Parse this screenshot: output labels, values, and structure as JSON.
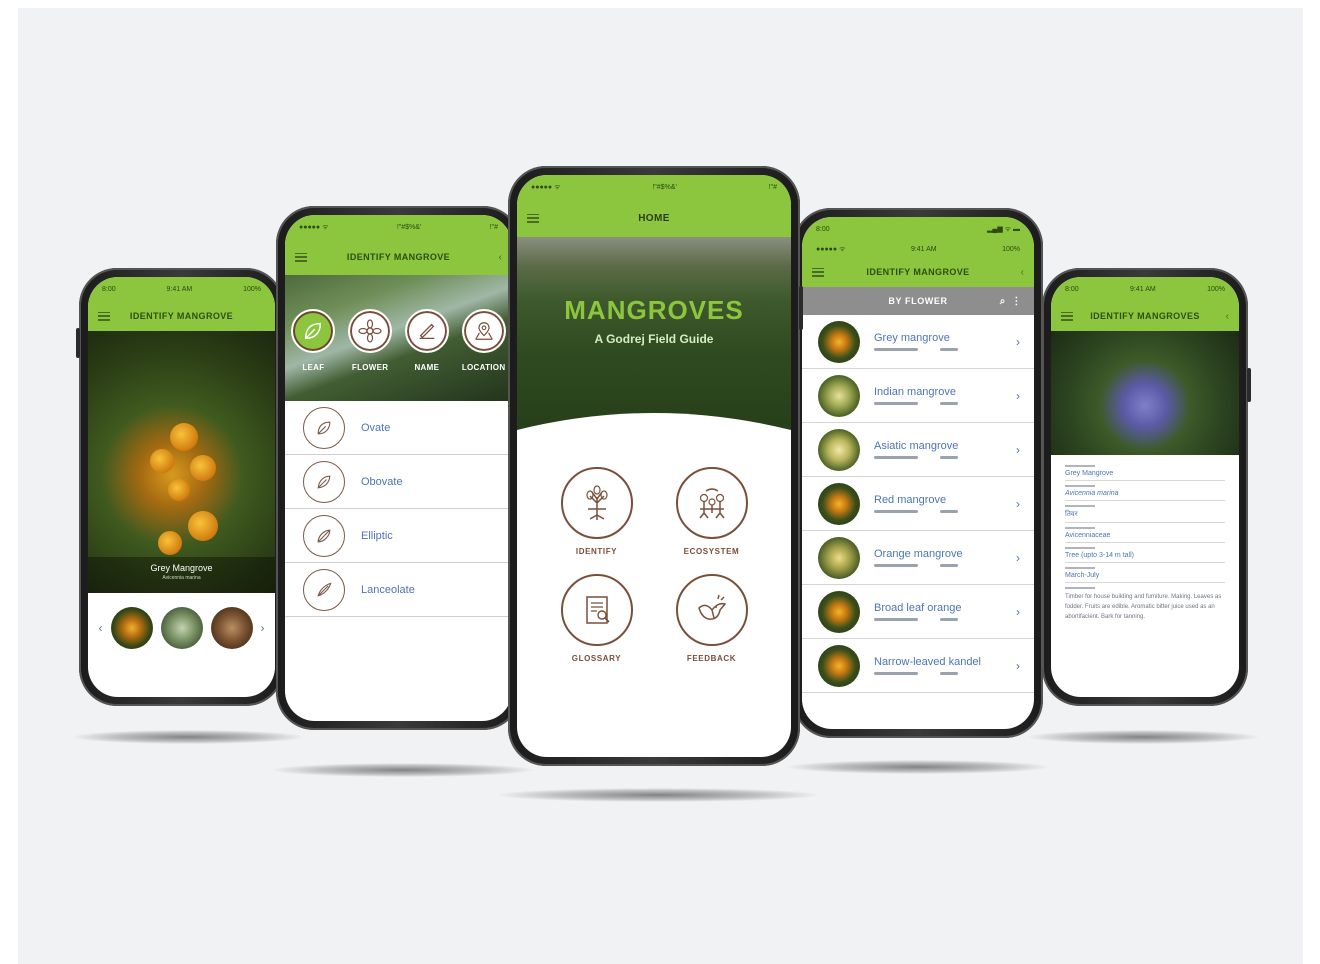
{
  "colors": {
    "app_green": "#8cc63f",
    "brown": "#7a4f3a",
    "link_blue": "#4d74b8",
    "background": "#f1f2f4"
  },
  "phone1": {
    "status": {
      "time": "9:41 AM",
      "left": "8:00",
      "battery": "100%"
    },
    "title": "IDENTIFY MANGROVE",
    "caption_name": "Grey Mangrove",
    "caption_sub": "Avicennia marina",
    "nav_prev": "‹",
    "nav_next": "›"
  },
  "phone2": {
    "status": {
      "carrier": "●●●●● ᯤ",
      "time": "!\"#$%&'",
      "right": "!\"#"
    },
    "title": "IDENTIFY MANGROVE",
    "categories": [
      {
        "label": "LEAF",
        "icon": "leaf-icon"
      },
      {
        "label": "FLOWER",
        "icon": "flower-icon"
      },
      {
        "label": "NAME",
        "icon": "pen-icon"
      },
      {
        "label": "LOCATION",
        "icon": "map-icon"
      }
    ],
    "leaf_shapes": [
      "Ovate",
      "Obovate",
      "Elliptic",
      "Lanceolate"
    ]
  },
  "phone3": {
    "status": {
      "carrier": "●●●●● ᯤ",
      "time": "!\"#$%&'",
      "right": "!\"#"
    },
    "title": "HOME",
    "hero_title": "MANGROVES",
    "hero_subtitle": "A Godrej Field Guide",
    "menu": [
      {
        "label": "IDENTIFY",
        "icon": "tree-roots-icon"
      },
      {
        "label": "ECOSYSTEM",
        "icon": "ecosystem-icon"
      },
      {
        "label": "GLOSSARY",
        "icon": "book-search-icon"
      },
      {
        "label": "FEEDBACK",
        "icon": "bird-icon"
      }
    ]
  },
  "phone4": {
    "status": {
      "left": "8:00",
      "time": "9:41 AM",
      "battery": "100%"
    },
    "title": "IDENTIFY MANGROVE",
    "filter": "BY FLOWER",
    "list": [
      "Grey mangrove",
      "Indian mangrove",
      "Asiatic mangrove",
      "Red mangrove",
      "Orange mangrove",
      "Broad leaf orange",
      "Narrow-leaved kandel"
    ]
  },
  "phone5": {
    "status": {
      "left": "8:00",
      "time": "9:41 AM",
      "battery": "100%"
    },
    "title": "IDENTIFY MANGROVES",
    "details": [
      "Grey Mangrove",
      "Avicennia marina",
      "तिवर",
      "Avicenniaceae",
      "Tree (upto 3-14 m tall)",
      "March-July"
    ],
    "uses": "Timber for house building and furniture. Making. Leaves as fodder. Fruits are edible. Aromatic bitter juice used as an abortifacient. Bark for tanning."
  }
}
